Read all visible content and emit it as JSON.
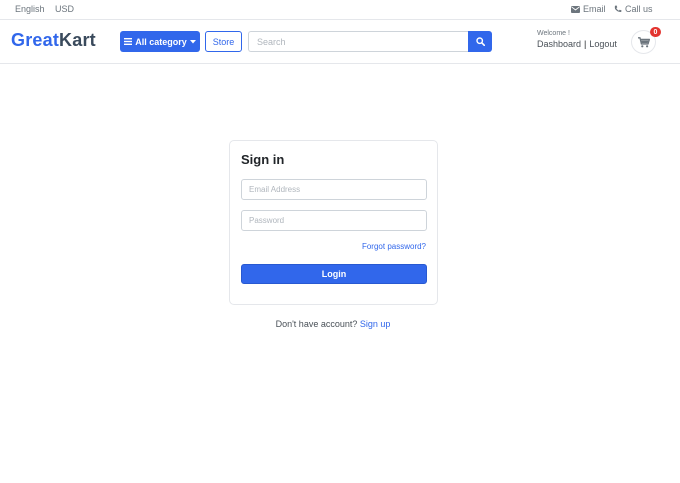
{
  "topbar": {
    "language": "English",
    "currency": "USD",
    "email_label": "Email",
    "call_label": "Call us"
  },
  "header": {
    "logo_part1": "Great",
    "logo_part2": "Kart",
    "category_button": "All category",
    "store_button": "Store",
    "search": {
      "placeholder": "Search",
      "value": ""
    },
    "welcome": "Welcome !",
    "dashboard_link": "Dashboard",
    "separator": "|",
    "logout_link": "Logout",
    "cart_count": "0"
  },
  "signin": {
    "title": "Sign in",
    "email": {
      "placeholder": "Email Address",
      "value": ""
    },
    "password": {
      "placeholder": "Password",
      "value": ""
    },
    "forgot_link": "Forgot password?",
    "login_button": "Login"
  },
  "footer_prompt": {
    "text": "Don't have account?",
    "signup_link": "Sign up"
  },
  "colors": {
    "primary": "#3167eb",
    "logo_dark": "#3a4a5c",
    "badge": "#e3342f",
    "border": "#e5e7eb"
  },
  "icons": [
    "envelope-icon",
    "phone-icon",
    "bars-icon",
    "caret-down-icon",
    "search-icon",
    "cart-icon"
  ]
}
